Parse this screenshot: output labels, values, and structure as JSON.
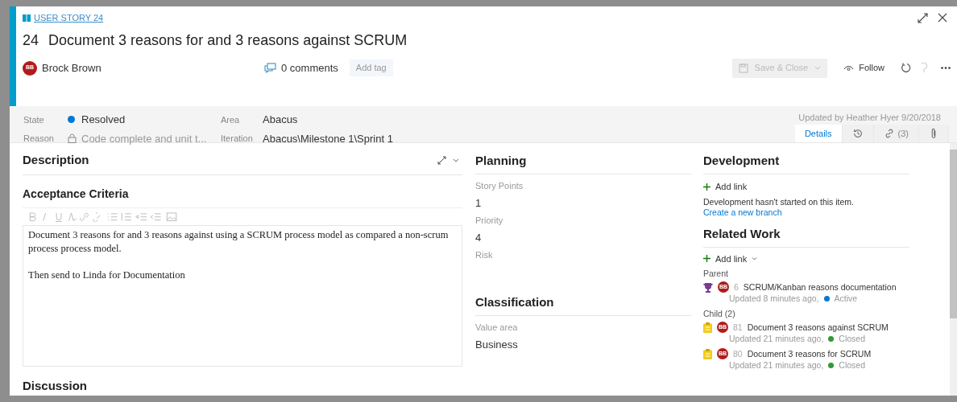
{
  "work_item": {
    "type_link": "USER STORY 24",
    "id": "24",
    "title": "Document 3 reasons for and 3 reasons against SCRUM",
    "assignee": {
      "initials": "BB",
      "name": "Brock Brown"
    },
    "comments": "0 comments",
    "add_tag": "Add tag"
  },
  "toolbar": {
    "save": {
      "label": "Save & Close",
      "disabled": true
    },
    "follow": "Follow",
    "undo_disabled": true
  },
  "fields": [
    {
      "label": "State",
      "value": "Resolved",
      "kind": "state",
      "color": "#0078d4"
    },
    {
      "label": "Area",
      "value": "Abacus",
      "kind": "text"
    },
    {
      "label": "Reason",
      "value": "Code complete and unit t...",
      "kind": "locked"
    },
    {
      "label": "Iteration",
      "value": "Abacus\\Milestone 1\\Sprint 1",
      "kind": "text"
    }
  ],
  "updated_by": "Updated by Heather Hyer 9/20/2018",
  "tabs": [
    {
      "kind": "text",
      "label": "Details",
      "selected": true
    },
    {
      "kind": "history",
      "selected": false
    },
    {
      "kind": "links",
      "label": "(3)",
      "selected": false
    },
    {
      "kind": "attachments",
      "selected": false
    }
  ],
  "description": {
    "heading": "Description",
    "acceptance_heading": "Acceptance Criteria",
    "paragraphs": [
      "Document 3 reasons for and 3 reasons against using a SCRUM process model as compared a non-scrum process process model.",
      "Then send to Linda for Documentation"
    ],
    "next_heading": "Discussion"
  },
  "planning": {
    "heading": "Planning",
    "fields": [
      {
        "label": "Story Points",
        "value": "1"
      },
      {
        "label": "Priority",
        "value": "4"
      },
      {
        "label": "Risk"
      }
    ]
  },
  "classification": {
    "heading": "Classification",
    "fields": [
      {
        "label": "Value area",
        "value": "Business"
      }
    ]
  },
  "development": {
    "heading": "Development",
    "add_link": "Add link",
    "note": "Development hasn't started on this item.",
    "branch_link": "Create a new branch"
  },
  "related_work": {
    "heading": "Related Work",
    "add_link": "Add link",
    "groups": [
      {
        "label": "Parent",
        "items": [
          {
            "kind": "epic",
            "initials": "BB",
            "id": "6",
            "title": "SCRUM/Kanban reasons documentation",
            "updated": "Updated 8 minutes ago,",
            "state": "Active",
            "color": "#0078d4"
          }
        ]
      },
      {
        "label": "Child (2)",
        "items": [
          {
            "kind": "task",
            "initials": "BB",
            "id": "81",
            "title": "Document 3 reasons against SCRUM",
            "updated": "Updated 21 minutes ago,",
            "state": "Closed",
            "color": "#339933"
          },
          {
            "kind": "task",
            "initials": "BB",
            "id": "80",
            "title": "Document 3 reasons for SCRUM",
            "updated": "Updated 21 minutes ago,",
            "state": "Closed",
            "color": "#339933"
          }
        ]
      }
    ]
  }
}
